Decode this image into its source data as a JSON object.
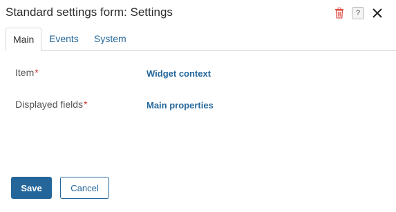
{
  "dialog": {
    "title": "Standard settings form: Settings",
    "icons": {
      "delete": "trash-icon",
      "help": "help-icon",
      "close": "close-icon"
    },
    "help_glyph": "?"
  },
  "tabs": [
    {
      "label": "Main",
      "active": true
    },
    {
      "label": "Events",
      "active": false
    },
    {
      "label": "System",
      "active": false
    }
  ],
  "fields": [
    {
      "label": "Item",
      "required_mark": "*",
      "value": "Widget context"
    },
    {
      "label": "Displayed fields",
      "required_mark": "*",
      "value": "Main properties"
    }
  ],
  "footer": {
    "save_label": "Save",
    "cancel_label": "Cancel"
  },
  "colors": {
    "accent": "#24669a",
    "required": "#d6332f",
    "delete": "#e0524a"
  }
}
